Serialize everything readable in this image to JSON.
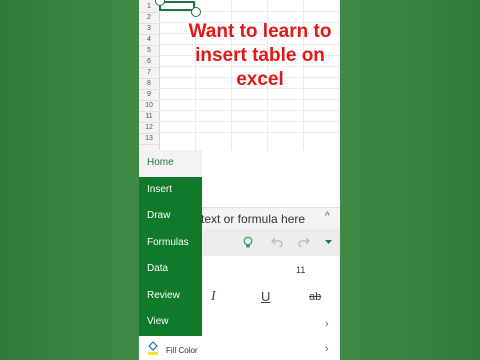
{
  "headline": {
    "line1": "Want to learn to",
    "line2": "insert table on",
    "line3": "excel"
  },
  "sheet": {
    "rows": [
      "1",
      "2",
      "3",
      "4",
      "5",
      "6",
      "7",
      "8",
      "9",
      "10",
      "11",
      "12",
      "13"
    ]
  },
  "formula_bar": {
    "placeholder_visible": "text or formula here"
  },
  "toolbar_icons": [
    "lightbulb-icon",
    "undo-icon",
    "redo-icon",
    "dropdown-caret-icon"
  ],
  "format": {
    "font_size": "11",
    "italic": "I",
    "underline": "U",
    "strike": "ab",
    "fill_color_label": "Fill Color"
  },
  "menu": {
    "items": [
      "Home",
      "Insert",
      "Draw",
      "Formulas",
      "Data",
      "Review",
      "View"
    ],
    "active": "Home"
  },
  "colors": {
    "accent": "#217346",
    "menu_bg": "#0e7a2a",
    "headline": "#e01818",
    "background": "#3f8a48"
  }
}
